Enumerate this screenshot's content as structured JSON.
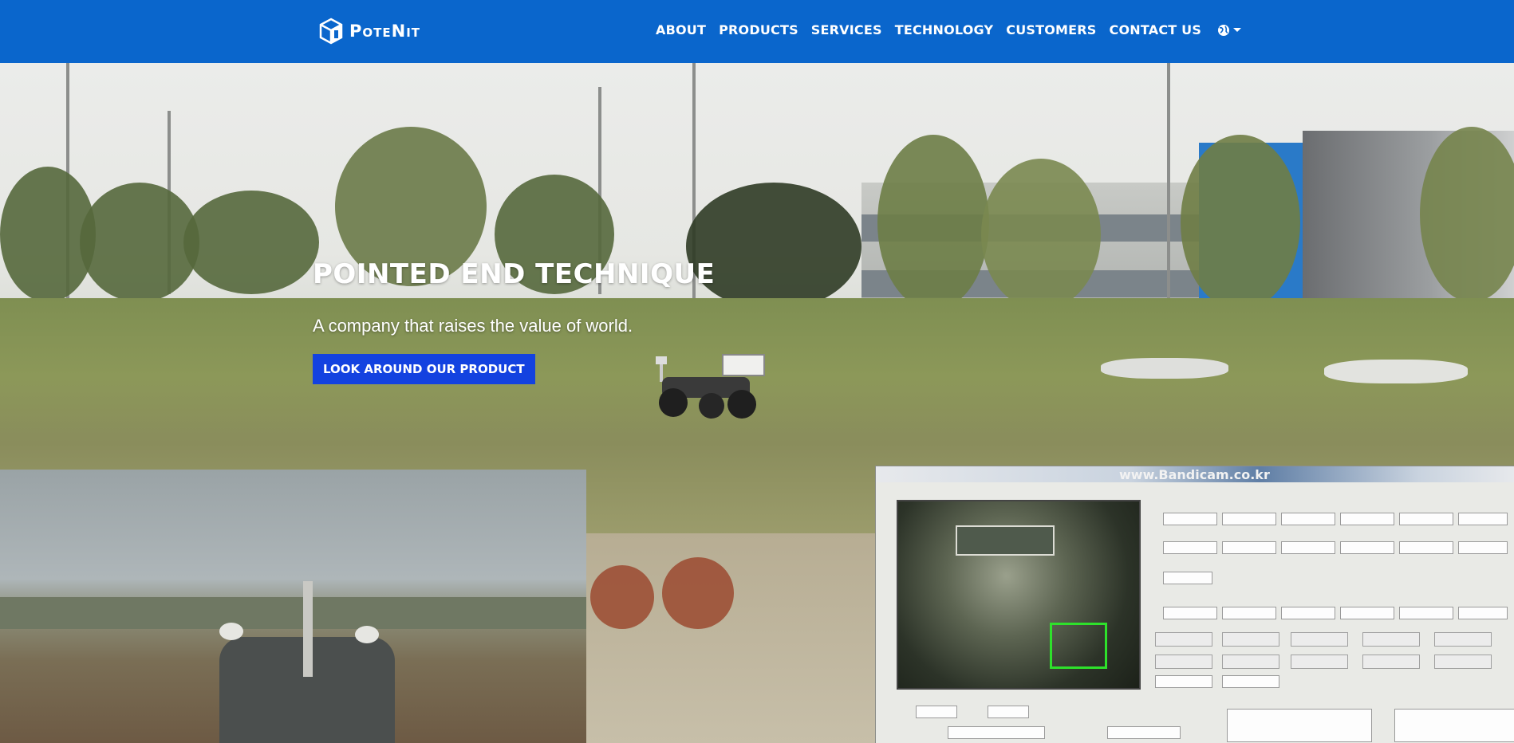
{
  "brand": {
    "name": "PoteNit",
    "logo_icon": "cube-logo-icon"
  },
  "nav": {
    "items": [
      {
        "label": "ABOUT"
      },
      {
        "label": "PRODUCTS"
      },
      {
        "label": "SERVICES"
      },
      {
        "label": "TECHNOLOGY"
      },
      {
        "label": "CUSTOMERS"
      },
      {
        "label": "CONTACT US"
      }
    ],
    "language_icon": "globe-icon",
    "dropdown_icon": "caret-down-icon"
  },
  "hero": {
    "title": "POINTED END TECHNIQUE",
    "subtitle": "A company that raises the value of world.",
    "cta_label": "LOOK AROUND OUR PRODUCT"
  },
  "video_overlay": {
    "watermark": "www.Bandicam.co.kr"
  },
  "colors": {
    "navbar": "#0a66cc",
    "cta": "#1342e0",
    "text_on_dark": "#ffffff"
  }
}
